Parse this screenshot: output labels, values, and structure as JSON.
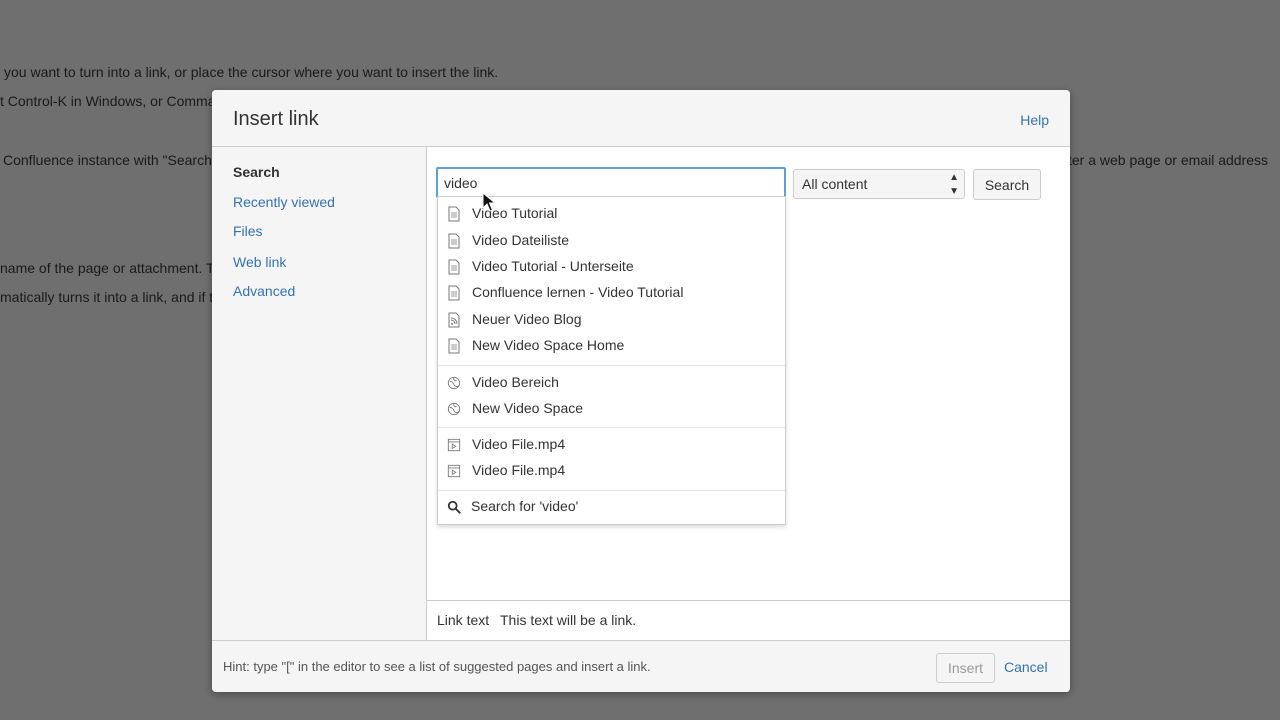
{
  "background": {
    "lines": [
      "you want to turn into a link, or place the cursor where you want to insert the link.",
      "t Control-K in Windows, or Comma",
      "Confluence instance with \"Search",
      "ter a web page or email address",
      "name of the page or attachment. T",
      "matically turns it into a link, and if t"
    ]
  },
  "dialog": {
    "title": "Insert link",
    "help": "Help"
  },
  "sidebar": {
    "items": [
      {
        "label": "Search"
      },
      {
        "label": "Recently viewed"
      },
      {
        "label": "Files"
      },
      {
        "label": "Web link"
      },
      {
        "label": "Advanced"
      }
    ]
  },
  "search": {
    "value": "video",
    "scope": "All content",
    "button": "Search"
  },
  "dropdown": {
    "pages": [
      {
        "label": "Video Tutorial",
        "icon": "page-icon"
      },
      {
        "label": "Video Dateiliste",
        "icon": "page-icon"
      },
      {
        "label": "Video Tutorial - Unterseite",
        "icon": "page-icon"
      },
      {
        "label": "Confluence lernen - Video Tutorial",
        "icon": "page-icon"
      },
      {
        "label": "Neuer Video Blog",
        "icon": "blog-icon"
      },
      {
        "label": "New Video Space Home",
        "icon": "page-icon"
      }
    ],
    "spaces": [
      {
        "label": "Video Bereich",
        "icon": "space-icon"
      },
      {
        "label": "New Video Space",
        "icon": "space-icon"
      }
    ],
    "files": [
      {
        "label": "Video File.mp4",
        "icon": "video-file-icon"
      },
      {
        "label": "Video File.mp4",
        "icon": "video-file-icon"
      }
    ],
    "search_for": "Search for 'video'"
  },
  "link_text": {
    "label": "Link text",
    "value": "This text will be a link."
  },
  "footer": {
    "hint": "Hint: type \"[\" in the editor to see a list of suggested pages and insert a link.",
    "insert": "Insert",
    "cancel": "Cancel"
  },
  "colors": {
    "link": "#3572b0",
    "overlay": "#6f6f6f",
    "focus_border": "#5f9fd8"
  }
}
